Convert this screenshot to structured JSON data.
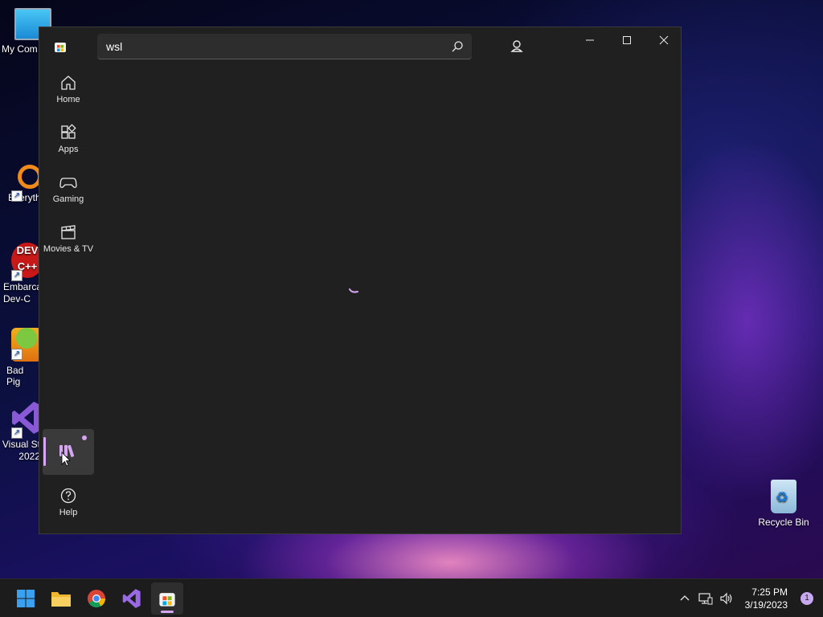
{
  "desktop": {
    "icons": [
      {
        "label": "My Com"
      },
      {
        "label": "Everyth"
      },
      {
        "label": "Embarca\nDev-C"
      },
      {
        "label": "Bad Pig"
      },
      {
        "label": "Visual St\n2022"
      },
      {
        "label": "Recycle Bin"
      }
    ]
  },
  "store": {
    "search_value": "wsl",
    "nav": [
      {
        "label": "Home"
      },
      {
        "label": "Apps"
      },
      {
        "label": "Gaming"
      },
      {
        "label": "Movies & TV"
      }
    ],
    "help_label": "Help"
  },
  "taskbar": {
    "time": "7:25 PM",
    "date": "3/19/2023",
    "notification_count": "1"
  },
  "colors": {
    "accent": "#d6a6f4",
    "window_bg": "#202020"
  }
}
